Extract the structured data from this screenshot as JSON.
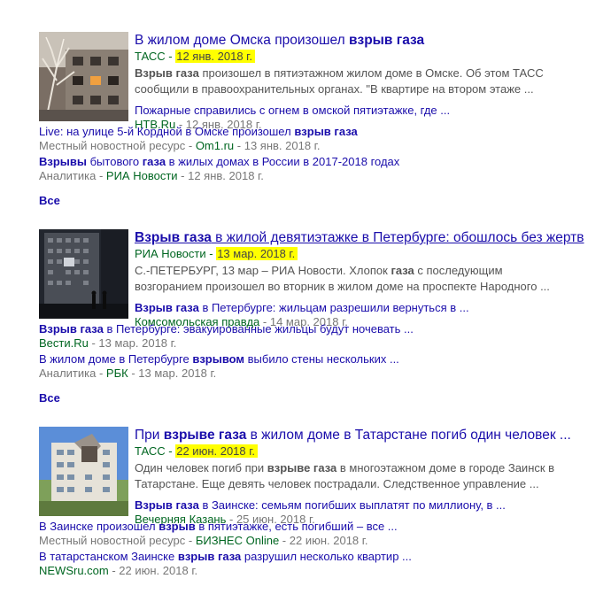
{
  "stories": [
    {
      "headline": {
        "pre": "В жилом доме Омска произошел ",
        "bold": "взрыв газа",
        "post": ""
      },
      "source": "ТАСС",
      "date": "12 янв. 2018 г.",
      "snippet_l1": {
        "bold": "Взрыв газа",
        "rest": " произошел в пятиэтажном жилом доме в Омске. Об этом ТАСС"
      },
      "snippet_l2": "сообщили в правоохранительных органах. \"В квартире на втором этаже ...",
      "related1": {
        "text": "Пожарные справились с огнем в омской пятиэтажке, где ...",
        "source": "НТВ.Ru",
        "date": "12 янв. 2018 г."
      },
      "related2": {
        "pre": "Live: на улице 5-й Кордной в Омске произошел ",
        "bold": "взрыв газа",
        "type": "Местный новостной ресурс",
        "source": "Om1.ru",
        "date": "13 янв. 2018 г."
      },
      "related3": {
        "bold1": "Взрывы",
        "mid": " бытового ",
        "bold2": "газа",
        "post": " в жилых домах в России в 2017-2018 годах",
        "type": "Аналитика",
        "source": "РИА Новости",
        "date": "12 янв. 2018 г."
      },
      "all": "Все"
    },
    {
      "headline": {
        "bold": "Взрыв газа",
        "post": " в жилой девятиэтажке в Петербурге: обошлось без жертв"
      },
      "source": "РИА Новости",
      "date": "13 мар. 2018 г.",
      "snippet_l1": {
        "pre": "С.-ПЕТЕРБУРГ, 13 мар – РИА Новости. Хлопок ",
        "bold": "газа",
        "rest": " с последующим"
      },
      "snippet_l2": "возгоранием произошел во вторник в жилом доме на проспекте Народного ...",
      "related1": {
        "bold": "Взрыв газа",
        "text": " в Петербурге: жильцам разрешили вернуться в ...",
        "source": "Комсомольская правда",
        "date": "14 мар. 2018 г."
      },
      "related2": {
        "bold": "Взрыв газа",
        "post": " в Петербурге: эвакуированные жильцы будут ночевать ...",
        "source": "Вести.Ru",
        "date": "13 мар. 2018 г."
      },
      "related3": {
        "pre": "В жилом доме в Петербурге ",
        "bold": "взрывом",
        "post": " выбило стены нескольких ...",
        "type": "Аналитика",
        "source": "РБК",
        "date": "13 мар. 2018 г."
      },
      "all": "Все"
    },
    {
      "headline": {
        "pre": "При ",
        "bold": "взрыве газа",
        "post": " в жилом доме в Татарстане погиб один человек ..."
      },
      "source": "ТАСС",
      "date": "22 июн. 2018 г.",
      "snippet_l1": {
        "pre": "Один человек погиб при ",
        "bold": "взрыве газа",
        "rest": " в многоэтажном доме в городе Заинск в"
      },
      "snippet_l2": "Татарстане. Еще девять человек пострадали. Следственное управление ...",
      "related1": {
        "bold": "Взрыв газа",
        "text": " в Заинске: семьям погибших выплатят по миллиону, в ...",
        "source": "Вечерняя Казань",
        "date": "25 июн. 2018 г."
      },
      "related2": {
        "pre": "В Заинске произошел ",
        "bold": "взрыв",
        "post": " в пятиэтажке, есть погибший – все ...",
        "type": "Местный новостной ресурс",
        "source": "БИЗНЕС Online",
        "date": "22 июн. 2018 г."
      },
      "related3": {
        "pre": "В татарстанском Заинске ",
        "bold": "взрыв газа",
        "post": " разрушил несколько квартир ...",
        "source": "NEWSru.com",
        "date": "22 июн. 2018 г."
      }
    }
  ]
}
